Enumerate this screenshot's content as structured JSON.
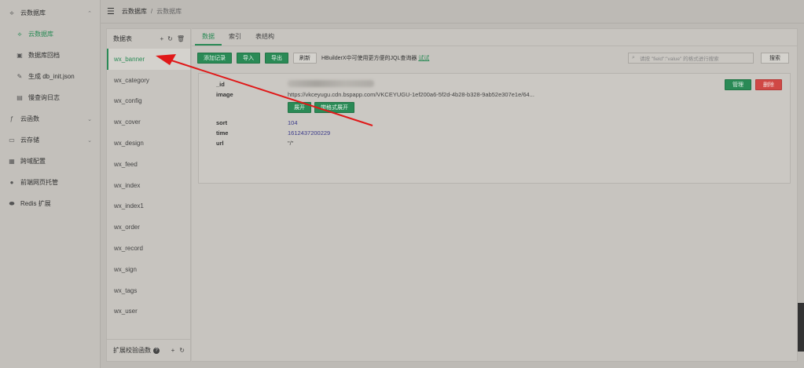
{
  "sidebar": {
    "items": [
      {
        "label": "云数据库",
        "icon": "database-icon",
        "chevron": "⌃"
      },
      {
        "label": "云数据库",
        "icon": "cloud-db-icon",
        "sub": true,
        "active": true
      },
      {
        "label": "数据库回档",
        "icon": "rollback-icon",
        "sub": true
      },
      {
        "label": "生成 db_init.json",
        "icon": "generate-icon",
        "sub": true
      },
      {
        "label": "慢查询日志",
        "icon": "log-icon",
        "sub": true
      },
      {
        "label": "云函数",
        "icon": "function-icon",
        "chevron": "⌄"
      },
      {
        "label": "云存储",
        "icon": "storage-icon",
        "chevron": "⌄"
      },
      {
        "label": "跨域配置",
        "icon": "cors-icon"
      },
      {
        "label": "前端网页托管",
        "icon": "hosting-icon"
      },
      {
        "label": "Redis 扩展",
        "icon": "redis-icon"
      }
    ]
  },
  "topbar": {
    "crumbs": [
      "云数据库",
      "云数据库"
    ],
    "separator": "/"
  },
  "tables_panel": {
    "title": "数据表",
    "items": [
      "wx_banner",
      "wx_category",
      "wx_config",
      "wx_cover",
      "wx_design",
      "wx_feed",
      "wx_index",
      "wx_index1",
      "wx_order",
      "wx_record",
      "wx_sign",
      "wx_tags",
      "wx_user"
    ],
    "footer": "扩展校验函数"
  },
  "main": {
    "tabs": [
      "数据",
      "索引",
      "表结构"
    ],
    "toolbar": {
      "add": "添加记录",
      "import": "导入",
      "export": "导出",
      "refresh": "刷新",
      "hint": "HBuilderX中可使用更方便的JQL查询器",
      "hint_link": "试试",
      "search_placeholder": "请按 \"field\":\"value\" 的格式进行搜索",
      "search_button": "搜索"
    },
    "record": {
      "fields": [
        {
          "name": "_id",
          "value": ""
        },
        {
          "name": "image",
          "value": "https://vkceyugu.cdn.bspapp.com/VKCEYUGU-1ef200a6-5f2d-4b28-b328-9ab52e307e1e/64..."
        },
        {
          "name": "sort",
          "value": "104"
        },
        {
          "name": "time",
          "value": "1612437200229"
        },
        {
          "name": "url",
          "value": "\"/\""
        }
      ],
      "expand": "展开",
      "expand_table": "带格式展开",
      "manage": "管理",
      "delete": "删除"
    }
  }
}
